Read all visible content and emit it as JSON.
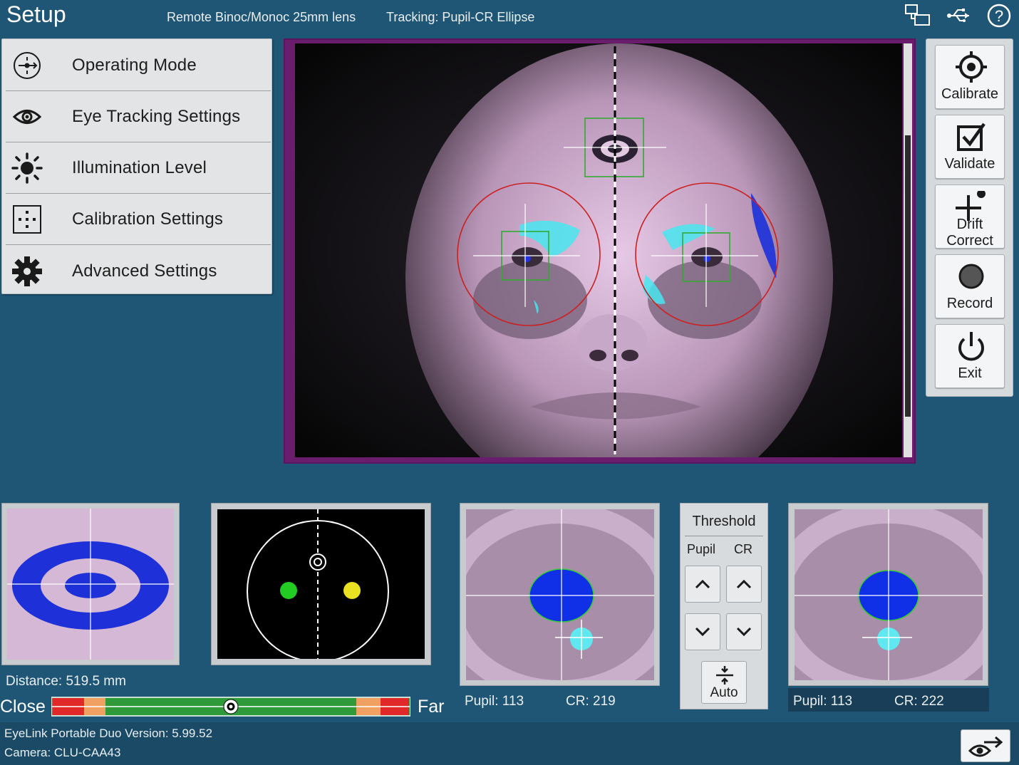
{
  "header": {
    "title": "Setup",
    "lens": "Remote Binoc/Monoc 25mm lens",
    "tracking": "Tracking: Pupil-CR Ellipse",
    "icons": [
      "network-icon",
      "usb-icon",
      "help-icon"
    ]
  },
  "menu": {
    "items": [
      {
        "label": "Operating Mode",
        "icon": "operating-mode-icon"
      },
      {
        "label": "Eye Tracking Settings",
        "icon": "eye-icon"
      },
      {
        "label": "Illumination Level",
        "icon": "sun-icon"
      },
      {
        "label": "Calibration Settings",
        "icon": "calibration-grid-icon"
      },
      {
        "label": "Advanced Settings",
        "icon": "gear-icon"
      }
    ]
  },
  "actions": {
    "calibrate": "Calibrate",
    "validate": "Validate",
    "drift_line1": "Drift",
    "drift_line2": "Correct",
    "record": "Record",
    "exit": "Exit"
  },
  "distance": {
    "text": "Distance:  519.5 mm",
    "close": "Close",
    "far": "Far",
    "position_fraction": 0.5
  },
  "left_eye": {
    "pupil": "Pupil: 113",
    "cr": "CR: 219"
  },
  "right_eye": {
    "pupil": "Pupil: 113",
    "cr": "CR: 222"
  },
  "threshold": {
    "title": "Threshold",
    "col_pupil": "Pupil",
    "col_cr": "CR",
    "auto": "Auto"
  },
  "footer": {
    "version": "EyeLink Portable Duo Version: 5.99.52",
    "camera": "Camera:  CLU-CAA43"
  },
  "colors": {
    "background": "#1f5676",
    "frame": "#6a1d6c",
    "pupil_fill": "#1432e6",
    "cr_fill": "#40e0f0",
    "target_left": "#22cc22",
    "target_right": "#e8e020",
    "dist_green": "#2e9a3a",
    "dist_red": "#e02828",
    "dist_orange": "#f0a060"
  }
}
